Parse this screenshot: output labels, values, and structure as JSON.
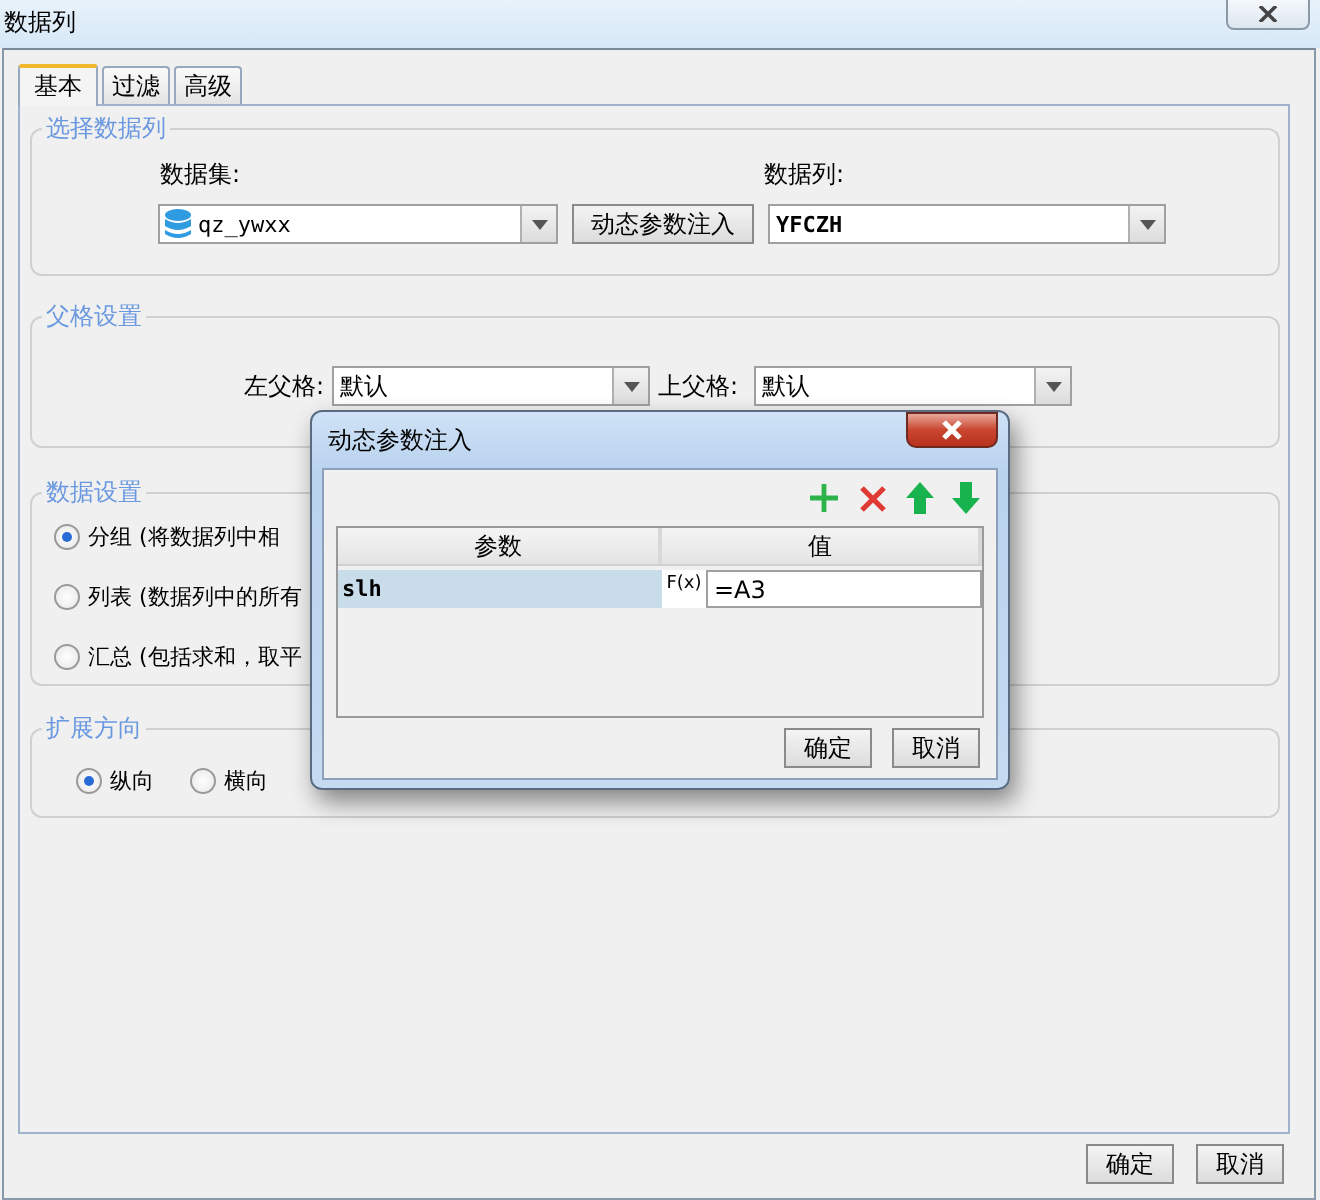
{
  "window": {
    "title": "数据列"
  },
  "tabs": [
    {
      "label": "基本",
      "selected": true
    },
    {
      "label": "过滤",
      "selected": false
    },
    {
      "label": "高级",
      "selected": false
    }
  ],
  "select_column": {
    "title": "选择数据列",
    "dataset_label": "数据集:",
    "dataset": "qz_ywxx",
    "inject_button": "动态参数注入",
    "column_label": "数据列:",
    "column": "YFCZH"
  },
  "parent_cells": {
    "title": "父格设置",
    "left_label": "左父格:",
    "left": "默认",
    "top_label": "上父格:",
    "top": "默认"
  },
  "data_settings": {
    "title": "数据设置",
    "options": [
      {
        "label": "分组 (将数据列中相",
        "selected": true
      },
      {
        "label": "列表 (数据列中的所有",
        "selected": false
      },
      {
        "label": "汇总 (包括求和，取平",
        "selected": false
      }
    ]
  },
  "expand_direction": {
    "title": "扩展方向",
    "options": [
      {
        "label": "纵向",
        "selected": true
      },
      {
        "label": "横向",
        "selected": false
      }
    ]
  },
  "buttons": [
    "确定",
    "取消"
  ],
  "dialog": {
    "title": "动态参数注入",
    "columns": [
      "参数",
      "值"
    ],
    "rows": [
      {
        "param": "slh",
        "formula_button": "F(x)",
        "value": "=A3",
        "selected": true
      }
    ],
    "buttons": [
      "确定",
      "取消"
    ]
  }
}
